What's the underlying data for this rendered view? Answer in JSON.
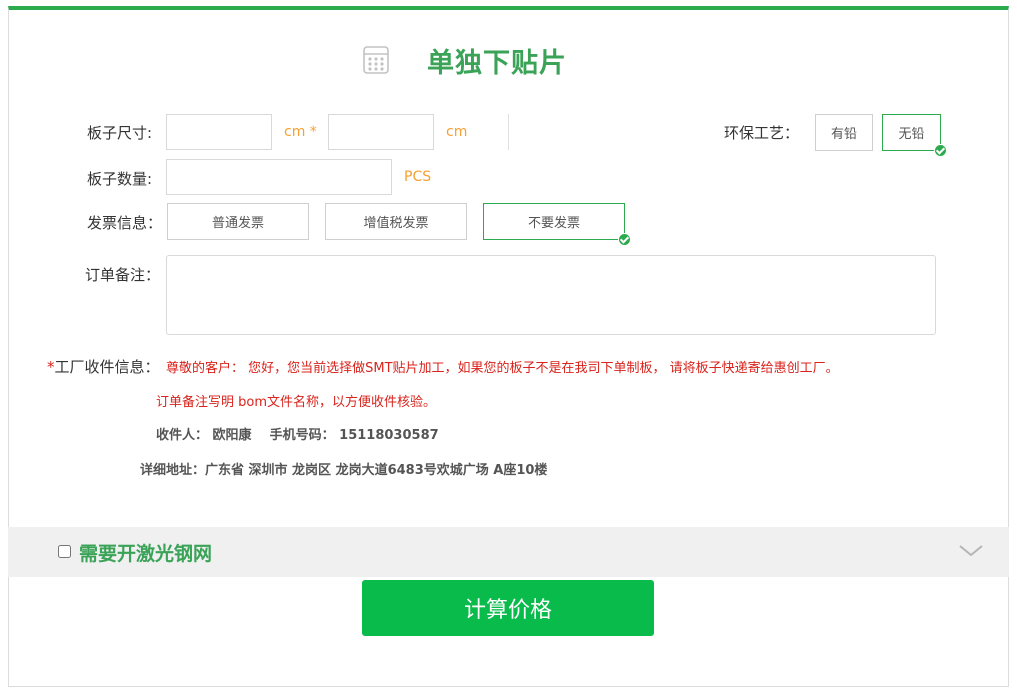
{
  "title": "单独下贴片",
  "title_icon": "calculator-icon",
  "board_size": {
    "label": "板子尺寸:",
    "width_value": "",
    "width_unit": "cm *",
    "height_value": "",
    "height_unit": "cm"
  },
  "eco_process": {
    "label": "环保工艺：",
    "options": [
      {
        "label": "有铅",
        "selected": false
      },
      {
        "label": "无铅",
        "selected": true
      }
    ]
  },
  "board_quantity": {
    "label": "板子数量:",
    "value": "",
    "unit": "PCS"
  },
  "invoice": {
    "label": "发票信息：",
    "options": [
      {
        "label": "普通发票",
        "selected": false
      },
      {
        "label": "增值税发票",
        "selected": false
      },
      {
        "label": "不要发票",
        "selected": true
      }
    ]
  },
  "order_remarks": {
    "label": "订单备注：",
    "value": ""
  },
  "factory_receipt": {
    "required_mark": "*",
    "label": "工厂收件信息：",
    "line1": "尊敬的客户： 您好，您当前选择做SMT贴片加工，如果您的板子不是在我司下单制板， 请将板子快递寄给惠创工厂。",
    "line2": "订单备注写明 bom文件名称，以方便收件核验。",
    "line3": "收件人： 欧阳康    手机号码： 15118030587",
    "line4": "详细地址：广东省 深圳市 龙岗区 龙岗大道6483号欢城广场 A座10楼"
  },
  "laser_stencil": {
    "label": "需要开激光钢网",
    "checked": false,
    "expand_icon": "chevron-down-icon"
  },
  "calculate_button": "计算价格",
  "colors": {
    "accent_green": "#2bab4e",
    "button_green": "#09bb4a",
    "unit_orange": "#f5a032",
    "notice_red": "#d9231c"
  }
}
